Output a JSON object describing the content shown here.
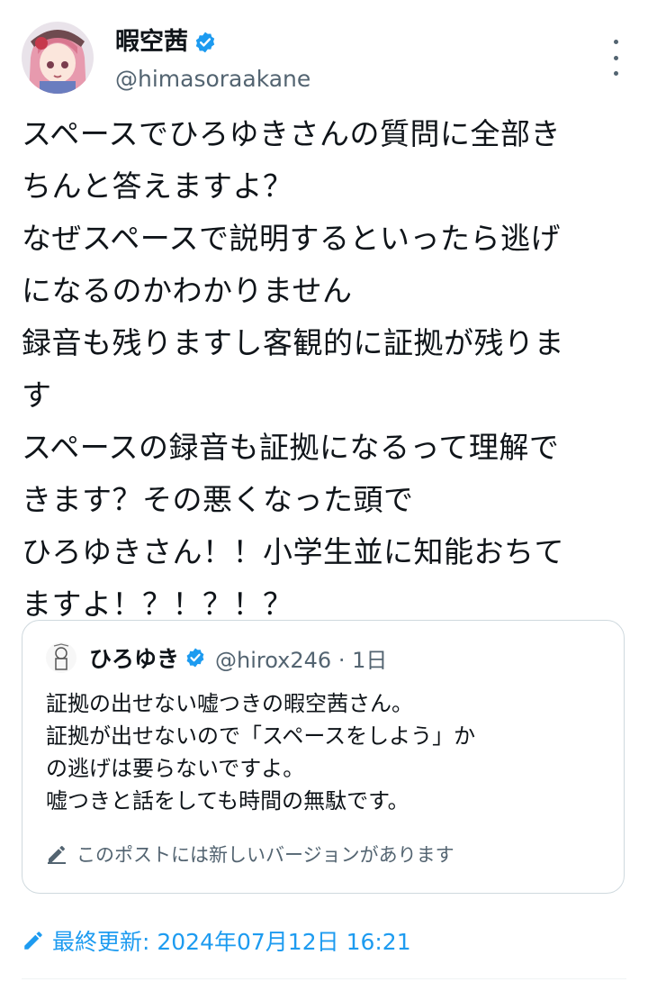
{
  "author": {
    "display_name": "暇空茜",
    "handle": "@himasoraakane"
  },
  "tweet": {
    "text": "スペースでひろゆきさんの質問に全部き\nちんと答えますよ？\nなぜスペースで説明するといったら逃げ\nになるのかわかりません\n録音も残りますし客観的に証拠が残りま\nす\nスペースの録音も証拠になるって理解で\nきます？その悪くなった頭で\nひろゆきさん！！小学生並に知能おちて\nますよ！？！？！？"
  },
  "quote": {
    "display_name": "ひろゆき",
    "handle_time": "@hirox246 · 1日",
    "text": "証拠の出せない嘘つきの暇空茜さん。\n証拠が出せないので「スペースをしよう」か\nの逃げは要らないですよ。\n嘘つきと話をしても時間の無駄です。",
    "edit_note": "このポストには新しいバージョンがあります"
  },
  "footer": {
    "last_updated": "最終更新: 2024年07月12日 16:21"
  },
  "icons": {
    "verified": "verified-badge-icon",
    "more": "more-vertical-icon",
    "edit": "pencil-icon"
  },
  "colors": {
    "accent": "#1d9bf0",
    "secondary_text": "#536471",
    "border": "#cfd9de"
  }
}
